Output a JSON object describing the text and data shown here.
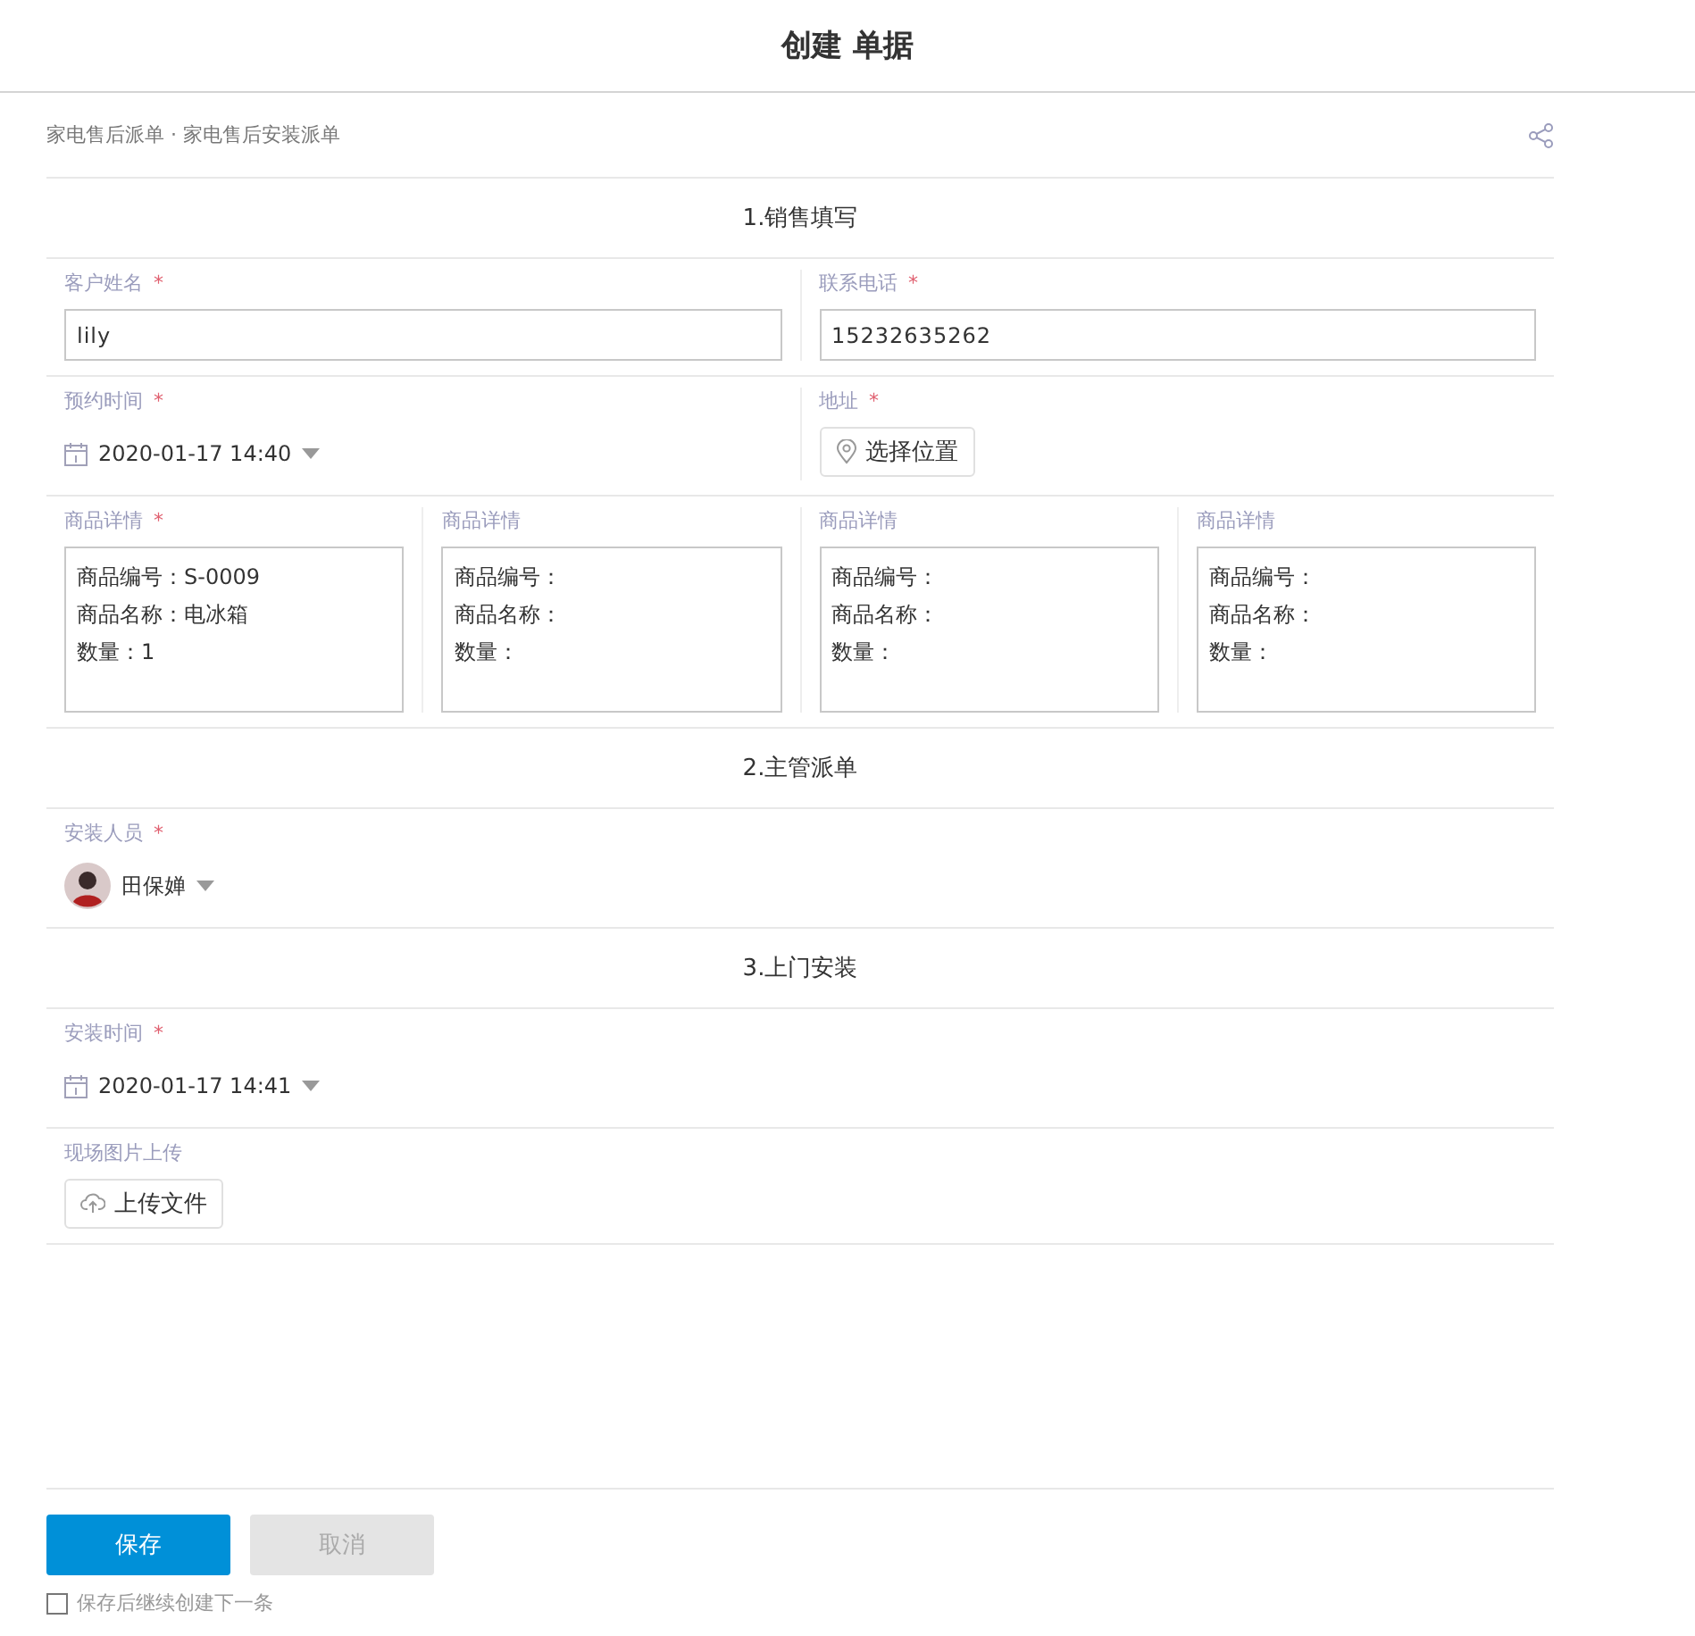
{
  "header": {
    "title": "创建 单据"
  },
  "breadcrumb": {
    "items": [
      "家电售后派单",
      "家电售后安装派单"
    ],
    "separator": "·"
  },
  "required_mark": "*",
  "sections": [
    {
      "title": "1.销售填写",
      "rows": [
        {
          "fields": [
            {
              "kind": "text",
              "label": "客户姓名",
              "required": true,
              "value": "lily"
            },
            {
              "kind": "text",
              "label": "联系电话",
              "required": true,
              "value": "15232635262"
            }
          ]
        },
        {
          "fields": [
            {
              "kind": "datetime",
              "label": "预约时间",
              "required": true,
              "value": "2020-01-17 14:40"
            },
            {
              "kind": "location",
              "label": "地址",
              "required": true,
              "button": "选择位置"
            }
          ]
        },
        {
          "fields": [
            {
              "kind": "textarea",
              "label": "商品详情",
              "required": true,
              "lines": [
                "商品编号：S-0009",
                "商品名称：电冰箱",
                "数量：1"
              ]
            },
            {
              "kind": "textarea",
              "label": "商品详情",
              "required": false,
              "lines": [
                "商品编号：",
                "商品名称：",
                "数量："
              ]
            },
            {
              "kind": "textarea",
              "label": "商品详情",
              "required": false,
              "lines": [
                "商品编号：",
                "商品名称：",
                "数量："
              ]
            },
            {
              "kind": "textarea",
              "label": "商品详情",
              "required": false,
              "lines": [
                "商品编号：",
                "商品名称：",
                "数量："
              ]
            }
          ]
        }
      ]
    },
    {
      "title": "2.主管派单",
      "rows": [
        {
          "fields": [
            {
              "kind": "user",
              "label": "安装人员",
              "required": true,
              "value": "田保婵"
            }
          ]
        }
      ]
    },
    {
      "title": "3.上门安装",
      "rows": [
        {
          "fields": [
            {
              "kind": "datetime",
              "label": "安装时间",
              "required": true,
              "value": "2020-01-17 14:41"
            }
          ]
        },
        {
          "fields": [
            {
              "kind": "upload",
              "label": "现场图片上传",
              "required": false,
              "button": "上传文件"
            }
          ]
        }
      ]
    }
  ],
  "footer": {
    "buttons": [
      {
        "kind": "primary",
        "label": "保存",
        "disabled": false
      },
      {
        "kind": "secondary",
        "label": "取消",
        "disabled": true
      }
    ],
    "checkbox": {
      "label": "保存后继续创建下一条",
      "checked": false
    }
  }
}
